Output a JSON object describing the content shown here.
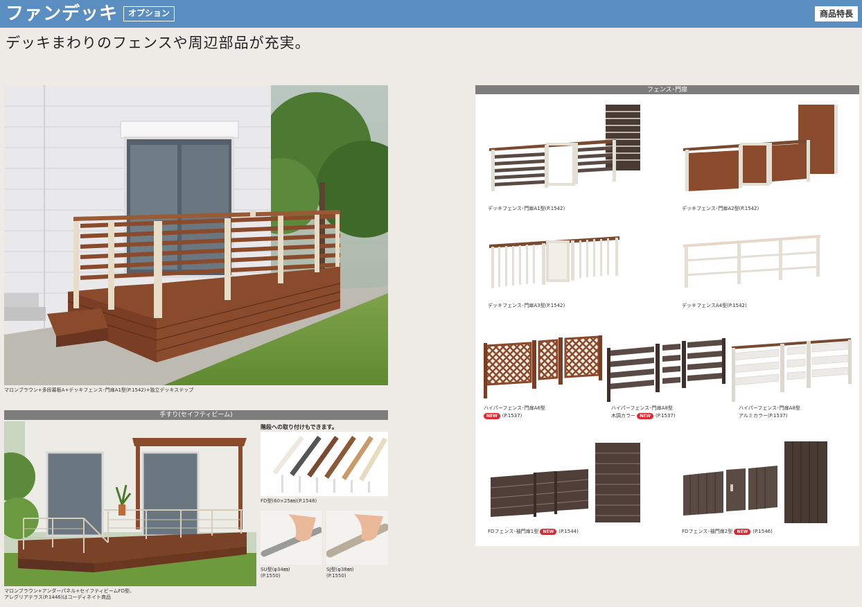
{
  "header": {
    "title": "ファンデッキ",
    "badge": "オプション",
    "feature_tag": "商品特長"
  },
  "subtitle": "デッキまわりのフェンスや周辺部品が充実。",
  "main_photo": {
    "caption": "マロンブラウン+多段幕板A+デッキフェンス･門扉A1型(P.1542)+独立デッキステップ"
  },
  "handrail": {
    "section_title": "手すり(セイフティビーム)",
    "stair_note": "階段への取り付けもできます。",
    "fd_caption": "FD型(60×25㎜)(P.1548)",
    "su_caption_1": "SU型(φ34㎜)",
    "su_caption_2": "(P.1550)",
    "sj_caption_1": "SJ型(φ38㎜)",
    "sj_caption_2": "(P.1550)",
    "photo_caption_1": "マロンブラウン+アンダーパネル+セイフティビームFD型、",
    "photo_caption_2": "アレグリアテラス(P.1446)はコーディネイト商品"
  },
  "fence": {
    "section_title": "フェンス･門扉",
    "a1": "デッキフェンス･門扉A1型(P.1542)",
    "a2": "デッキフェンス･門扉A2型(P.1542)",
    "a3": "デッキフェンス･門扉A3型(P.1542)",
    "a4": "デッキフェンスA4型(P.1542)",
    "hp_a6_1": "ハイパーフェンス･門扉A6型",
    "hp_a6_2": "(P.1537)",
    "hp_a8w_1": "ハイパーフェンス･門扉A8型",
    "hp_a8w_2": "木調カラー",
    "hp_a8w_3": "(P.1537)",
    "hp_a8a_1": "ハイパーフェンス･門扉A8型",
    "hp_a8a_2": "アルミカラー(P.1537)",
    "fd1": "FDフェンス･袖門扉1型",
    "fd1_p": "(P.1544)",
    "fd2": "FDフェンス･袖門扉2型",
    "fd2_p": "(P.1546)",
    "new_label": "NEW"
  },
  "colors": {
    "header_blue": "#5a8ec0",
    "section_gray": "#7d7d7d",
    "wood_brown": "#8a4a2c",
    "dark_brown": "#4a3a32",
    "new_red": "#e0262f"
  }
}
